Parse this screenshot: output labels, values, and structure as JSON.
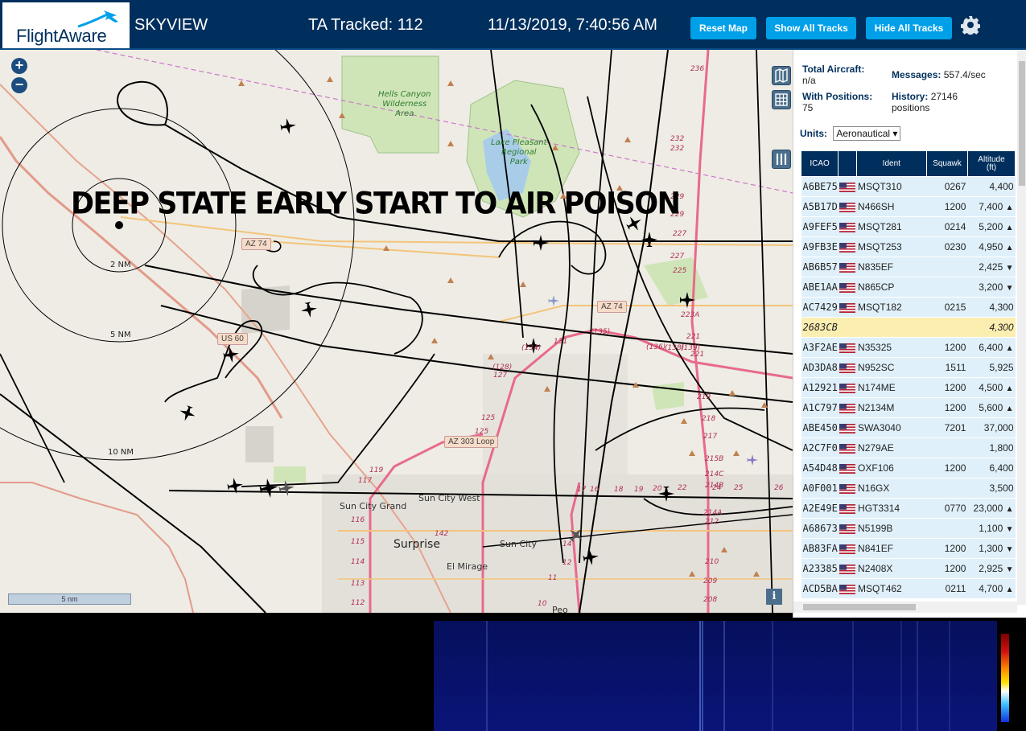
{
  "header": {
    "logo_text": "FlightAware",
    "site_name": "SKYVIEW",
    "ta_tracked": "TA Tracked: 112",
    "datetime": "11/13/2019, 7:40:56 AM",
    "buttons": {
      "reset": "Reset Map",
      "show_all": "Show All Tracks",
      "hide_all": "Hide All Tracks"
    },
    "icons": {
      "settings": "gear-icon"
    }
  },
  "map": {
    "overlay_caption": "DEEP STATE EARLY START TO AIR POISON",
    "zoom": {
      "in": "+",
      "out": "−"
    },
    "scale_bar": "5 nm",
    "info": "i",
    "range_rings": [
      "2 NM",
      "5 NM",
      "10 NM"
    ],
    "park_labels": {
      "hells_canyon": "Hells Canyon\nWilderness\nArea",
      "lake_pleasant": "Lake Pleasant\nRegional\nPark"
    },
    "places": {
      "surprise": "Surprise",
      "sun_city_grand": "Sun City Grand",
      "sun_city_west": "Sun City West",
      "sun_city": "Sun City",
      "el_mirage": "El Mirage",
      "peoria": "Peo"
    },
    "shields": {
      "az74_w": "AZ 74",
      "az74_e": "AZ 74",
      "us60": "US 60",
      "az303": "AZ 303 Loop"
    },
    "route_markers": [
      "236",
      "232",
      "232",
      "229",
      "229",
      "227",
      "227",
      "225",
      "223A",
      "221",
      "221",
      "219",
      "218",
      "217",
      "215B",
      "214C",
      "214B",
      "214A",
      "212",
      "210",
      "209",
      "208",
      "(135)",
      "(136)",
      "(138)",
      "(139)",
      "131",
      "(134)",
      "(128)",
      "127",
      "125",
      "125",
      "119",
      "117",
      "116",
      "115",
      "114",
      "113",
      "112",
      "142",
      "14",
      "12",
      "11",
      "10",
      "17",
      "16",
      "18",
      "19",
      "20",
      "22",
      "24",
      "25",
      "26"
    ]
  },
  "sidebar": {
    "total_aircraft_label": "Total Aircraft:",
    "total_aircraft_value": "n/a",
    "messages_label": "Messages:",
    "messages_value": "557.4/sec",
    "with_positions_label": "With Positions:",
    "with_positions_value": "75",
    "history_label": "History:",
    "history_value": "27146",
    "history_unit": "positions",
    "units_label": "Units:",
    "units_value": "Aeronautical",
    "table": {
      "headers": [
        "ICAO",
        "",
        "Ident",
        "Squawk",
        "Altitude\n(ft)"
      ],
      "rows": [
        {
          "icao": "A6BE75",
          "ident": "MSQT310",
          "squawk": "0267",
          "altitude": "4,400",
          "trend": ""
        },
        {
          "icao": "A5B17D",
          "ident": "N466SH",
          "squawk": "1200",
          "altitude": "7,400",
          "trend": "▲"
        },
        {
          "icao": "A9FEF5",
          "ident": "MSQT281",
          "squawk": "0214",
          "altitude": "5,200",
          "trend": "▲"
        },
        {
          "icao": "A9FB3E",
          "ident": "MSQT253",
          "squawk": "0230",
          "altitude": "4,950",
          "trend": "▲"
        },
        {
          "icao": "AB6B57",
          "ident": "N835EF",
          "squawk": "",
          "altitude": "2,425",
          "trend": "▼"
        },
        {
          "icao": "ABE1AA",
          "ident": "N865CP",
          "squawk": "",
          "altitude": "3,200",
          "trend": "▼"
        },
        {
          "icao": "AC7429",
          "ident": "MSQT182",
          "squawk": "0215",
          "altitude": "4,300",
          "trend": ""
        },
        {
          "icao": "2683CB",
          "ident": "",
          "squawk": "",
          "altitude": "4,300",
          "trend": ""
        },
        {
          "icao": "A3F2AE",
          "ident": "N35325",
          "squawk": "1200",
          "altitude": "6,400",
          "trend": "▲"
        },
        {
          "icao": "AD3DA8",
          "ident": "N952SC",
          "squawk": "1511",
          "altitude": "5,925",
          "trend": ""
        },
        {
          "icao": "A12921",
          "ident": "N174ME",
          "squawk": "1200",
          "altitude": "4,500",
          "trend": "▲"
        },
        {
          "icao": "A1C797",
          "ident": "N2134M",
          "squawk": "1200",
          "altitude": "5,600",
          "trend": "▲"
        },
        {
          "icao": "ABE450",
          "ident": "SWA3040",
          "squawk": "7201",
          "altitude": "37,000",
          "trend": ""
        },
        {
          "icao": "A2C7F0",
          "ident": "N279AE",
          "squawk": "",
          "altitude": "1,800",
          "trend": ""
        },
        {
          "icao": "A54D48",
          "ident": "OXF106",
          "squawk": "1200",
          "altitude": "6,400",
          "trend": ""
        },
        {
          "icao": "A0F001",
          "ident": "N16GX",
          "squawk": "",
          "altitude": "3,500",
          "trend": ""
        },
        {
          "icao": "A2E49E",
          "ident": "HGT3314",
          "squawk": "0770",
          "altitude": "23,000",
          "trend": "▲"
        },
        {
          "icao": "A68673",
          "ident": "N5199B",
          "squawk": "",
          "altitude": "1,100",
          "trend": "▼"
        },
        {
          "icao": "AB83FA",
          "ident": "N841EF",
          "squawk": "1200",
          "altitude": "1,300",
          "trend": "▼"
        },
        {
          "icao": "A23385",
          "ident": "N2408X",
          "squawk": "1200",
          "altitude": "2,925",
          "trend": "▼"
        },
        {
          "icao": "ACD5BA",
          "ident": "MSQT462",
          "squawk": "0211",
          "altitude": "4,700",
          "trend": "▲"
        }
      ]
    }
  },
  "colors": {
    "header_bg": "#002f5d",
    "button_bg": "#00a0e9",
    "row_bg": "#dff0fa",
    "row_highlight": "#fbeeb0"
  }
}
